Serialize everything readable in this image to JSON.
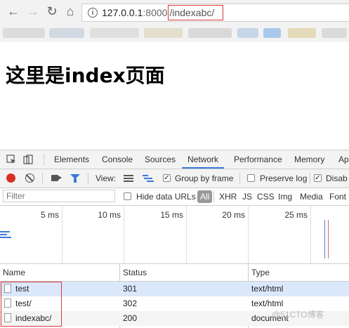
{
  "browser": {
    "url_host": "127.0.0.1",
    "url_port": ":8000",
    "url_path": "/indexabc/"
  },
  "page": {
    "heading": "这里是index页面"
  },
  "devtools": {
    "tabs": [
      "Elements",
      "Console",
      "Sources",
      "Network",
      "Performance",
      "Memory",
      "Ap"
    ],
    "active_tab": "Network",
    "toolbar": {
      "view_label": "View:",
      "group_by_frame": "Group by frame",
      "group_by_frame_checked": true,
      "preserve_log": "Preserve log",
      "preserve_log_checked": false,
      "disable_cache": "Disab",
      "disable_cache_checked": true
    },
    "filter": {
      "placeholder": "Filter",
      "hide_data_urls": "Hide data URLs",
      "all": "All",
      "types": [
        "XHR",
        "JS",
        "CSS",
        "Img",
        "Media",
        "Font"
      ]
    },
    "timeline_ticks": [
      "5 ms",
      "10 ms",
      "15 ms",
      "20 ms",
      "25 ms"
    ],
    "table": {
      "columns": [
        "Name",
        "Status",
        "Type"
      ],
      "rows": [
        {
          "name": "test",
          "status": "301",
          "type": "text/html"
        },
        {
          "name": "test/",
          "status": "302",
          "type": "text/html"
        },
        {
          "name": "indexabc/",
          "status": "200",
          "type": "document"
        }
      ]
    },
    "watermark": "@51CTO博客"
  },
  "colors": {
    "accent": "#3879d9",
    "record": "#d93025",
    "highlight": "#d9383a",
    "selected_row": "#dbe8fb"
  }
}
